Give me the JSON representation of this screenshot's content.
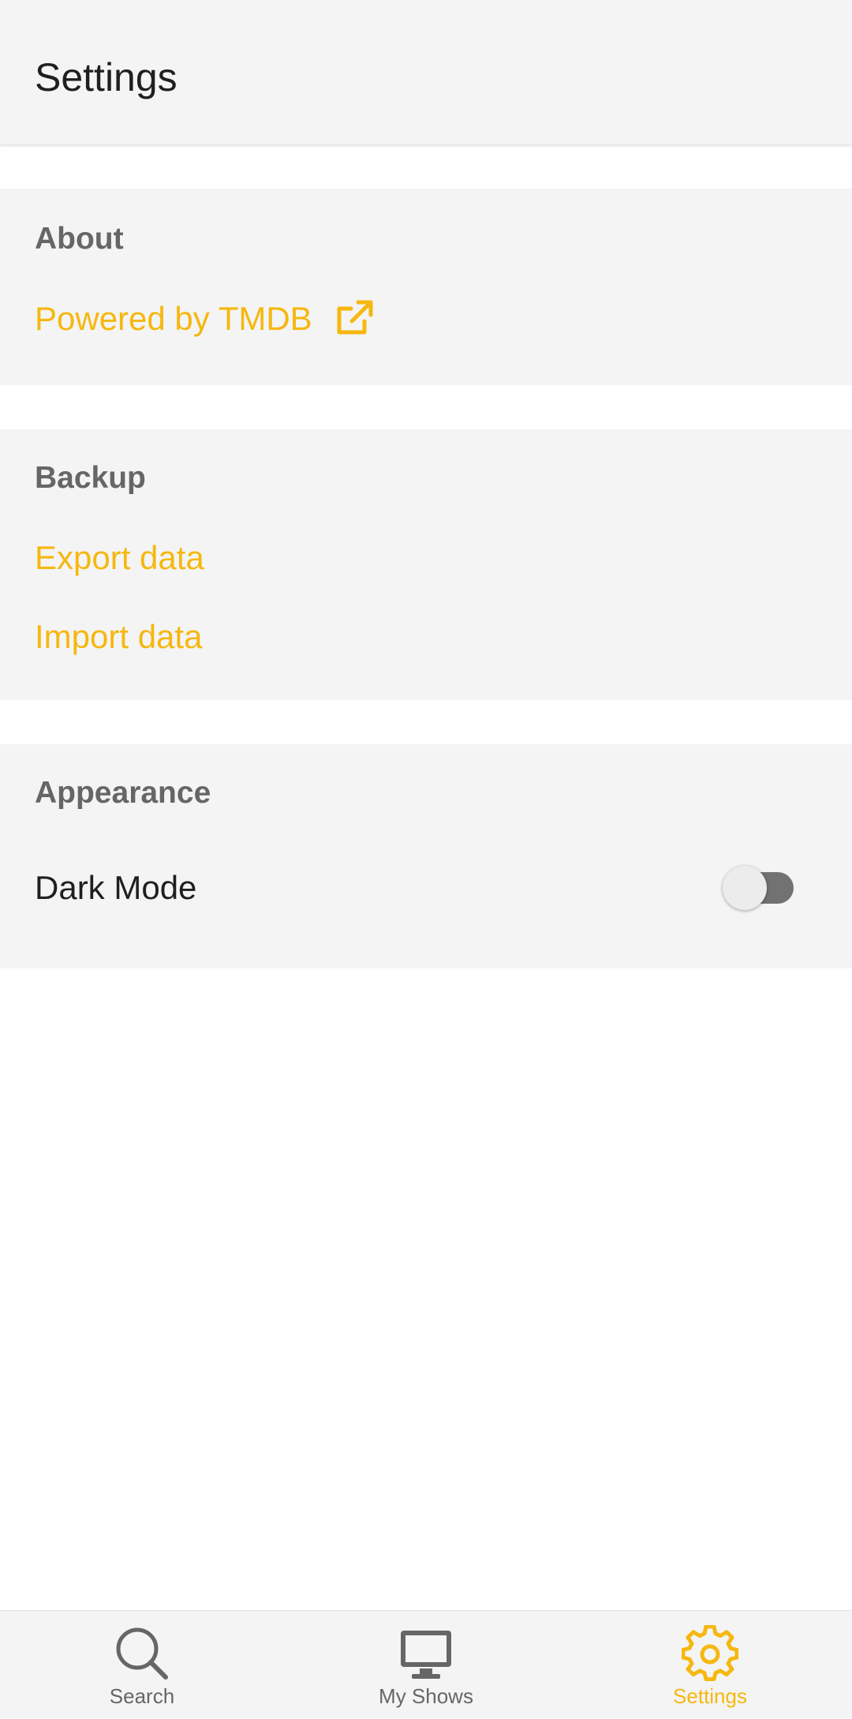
{
  "app_bar": {
    "title": "Settings"
  },
  "sections": {
    "about": {
      "title": "About",
      "powered_by_label": "Powered by TMDB"
    },
    "backup": {
      "title": "Backup",
      "export_label": "Export data",
      "import_label": "Import data"
    },
    "appearance": {
      "title": "Appearance",
      "dark_mode_label": "Dark Mode",
      "dark_mode_enabled": false
    }
  },
  "bottom_nav": {
    "items": [
      {
        "label": "Search",
        "icon": "search-icon",
        "active": false
      },
      {
        "label": "My Shows",
        "icon": "tv-icon",
        "active": false
      },
      {
        "label": "Settings",
        "icon": "gear-icon",
        "active": true
      }
    ]
  },
  "colors": {
    "accent": "#f6b70f",
    "section_background": "#f4f4f4",
    "inactive_nav": "#666666",
    "toggle_track_off": "#727272"
  }
}
